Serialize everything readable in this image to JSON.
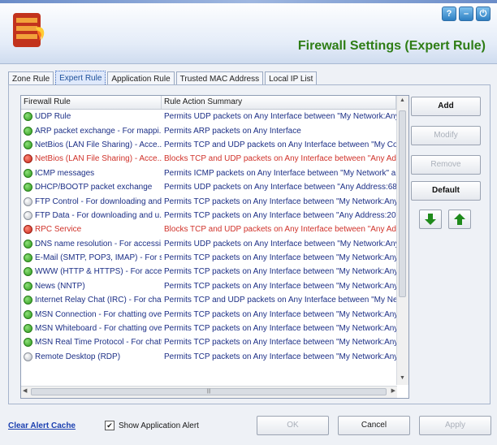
{
  "header": {
    "title": "Firewall Settings (Expert Rule)",
    "window_buttons": [
      {
        "icon": "help-icon",
        "glyph": "?"
      },
      {
        "icon": "minimize-icon",
        "glyph": "–"
      },
      {
        "icon": "power-icon",
        "glyph": "⏻"
      }
    ]
  },
  "tabs": [
    {
      "label": "Zone Rule",
      "active": false
    },
    {
      "label": "Expert Rule",
      "active": true
    },
    {
      "label": "Application Rule",
      "active": false
    },
    {
      "label": "Trusted MAC Address",
      "active": false
    },
    {
      "label": "Local IP List",
      "active": false
    }
  ],
  "table": {
    "columns": [
      "Firewall Rule",
      "Rule Action Summary"
    ],
    "rows": [
      {
        "rule": "UDP Rule",
        "summary": "Permits UDP packets on Any Interface between \"My Network:Any\"",
        "status": "green",
        "action": "permit"
      },
      {
        "rule": "ARP packet exchange - For mappi...",
        "summary": "Permits ARP packets on Any Interface",
        "status": "green",
        "action": "permit"
      },
      {
        "rule": "NetBios (LAN File Sharing) - Acce...",
        "summary": "Permits TCP and UDP packets on Any Interface between \"My Com",
        "status": "green",
        "action": "permit"
      },
      {
        "rule": "NetBios (LAN File Sharing) - Acce...",
        "summary": "Blocks TCP and UDP packets on Any Interface between \"Any Add",
        "status": "red",
        "action": "block"
      },
      {
        "rule": "ICMP messages",
        "summary": "Permits ICMP packets on Any Interface between \"My Network\" an",
        "status": "green",
        "action": "permit"
      },
      {
        "rule": "DHCP/BOOTP packet exchange",
        "summary": "Permits UDP packets on Any Interface between \"Any Address:68\"",
        "status": "green",
        "action": "permit"
      },
      {
        "rule": "FTP Control - For downloading and...",
        "summary": "Permits TCP packets on Any Interface between \"My Network:Any\"",
        "status": "grey",
        "action": "permit"
      },
      {
        "rule": "FTP Data - For downloading and u...",
        "summary": "Permits TCP packets on Any Interface between \"Any Address:20\"",
        "status": "grey",
        "action": "permit"
      },
      {
        "rule": "RPC Service",
        "summary": "Blocks TCP and UDP packets on Any Interface between \"Any Add",
        "status": "red",
        "action": "block"
      },
      {
        "rule": "DNS name resolution - For accessi...",
        "summary": "Permits UDP packets on Any Interface between \"My Network:Any\"",
        "status": "green",
        "action": "permit"
      },
      {
        "rule": "E-Mail (SMTP, POP3, IMAP) - For se...",
        "summary": "Permits TCP packets on Any Interface between \"My Network:Any\"",
        "status": "green",
        "action": "permit"
      },
      {
        "rule": "WWW (HTTP & HTTPS) - For acce...",
        "summary": "Permits TCP packets on Any Interface between \"My Network:Any\"",
        "status": "green",
        "action": "permit"
      },
      {
        "rule": "News (NNTP)",
        "summary": "Permits TCP packets on Any Interface between \"My Network:Any\"",
        "status": "green",
        "action": "permit"
      },
      {
        "rule": "Internet Relay Chat (IRC) - For chat...",
        "summary": "Permits TCP and UDP packets on Any Interface between \"My Net",
        "status": "green",
        "action": "permit"
      },
      {
        "rule": "MSN Connection - For chatting ove...",
        "summary": "Permits TCP packets on Any Interface between \"My Network:Any\"",
        "status": "green",
        "action": "permit"
      },
      {
        "rule": "MSN Whiteboard - For chatting ove...",
        "summary": "Permits TCP packets on Any Interface between \"My Network:Any\"",
        "status": "green",
        "action": "permit"
      },
      {
        "rule": "MSN Real Time Protocol - For chatti...",
        "summary": "Permits TCP packets on Any Interface between \"My Network:Any\"",
        "status": "green",
        "action": "permit"
      },
      {
        "rule": "Remote Desktop (RDP)",
        "summary": "Permits TCP packets on Any Interface between \"My Network:Any\"",
        "status": "grey",
        "action": "permit"
      }
    ]
  },
  "side_buttons": {
    "add": "Add",
    "modify": "Modify",
    "remove": "Remove",
    "default": "Default"
  },
  "arrows": {
    "down_icon": "arrow-down-icon",
    "up_icon": "arrow-up-icon",
    "color": "#1f8a1a"
  },
  "footer": {
    "clear_alert_cache": "Clear Alert Cache",
    "show_application_alert": "Show Application Alert",
    "show_application_alert_checked": true,
    "ok": "OK",
    "cancel": "Cancel",
    "apply": "Apply"
  },
  "colors": {
    "title_green": "#2e7d15",
    "permit_text": "#1c2f86",
    "block_text": "#d0322a",
    "link_blue": "#1a3fb0"
  }
}
